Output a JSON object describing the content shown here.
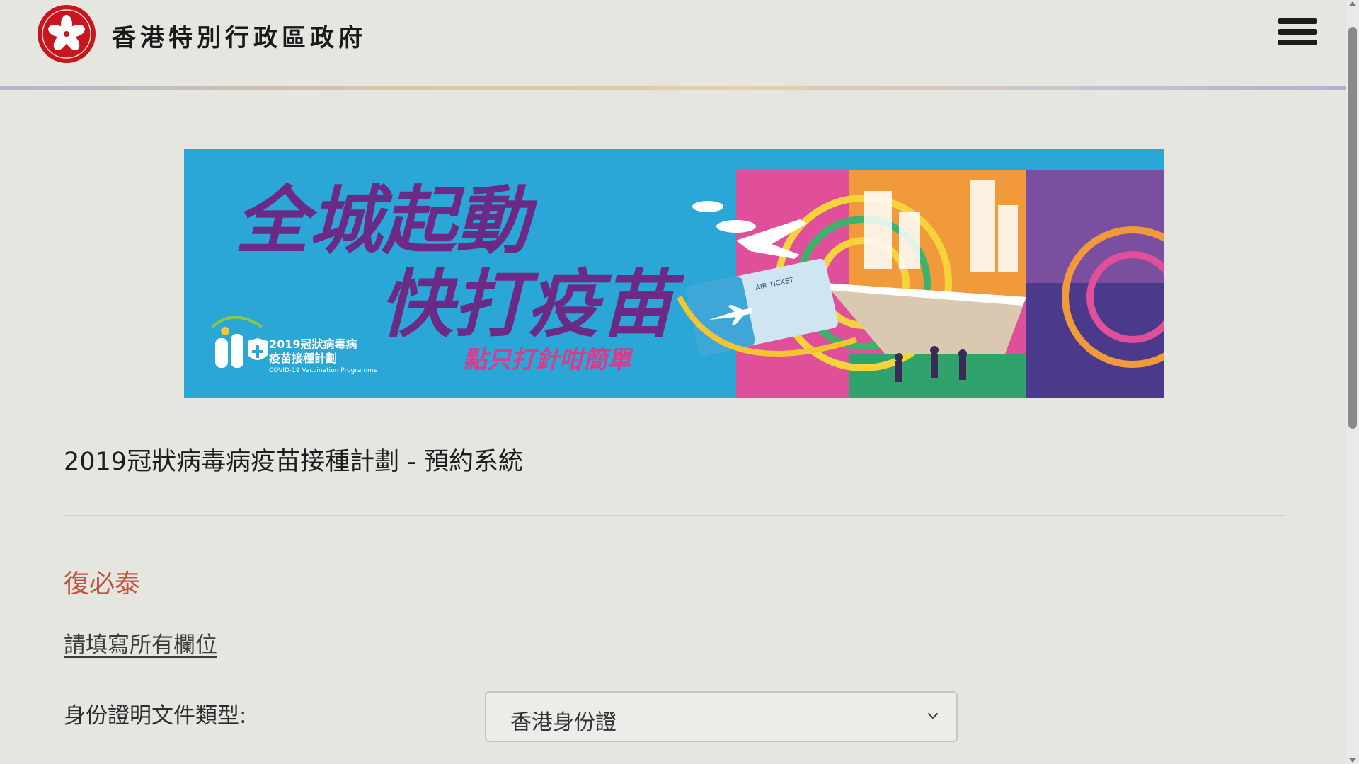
{
  "header": {
    "gov_name": "香港特別行政區政府",
    "emblem_icon": "hksar-emblem-icon",
    "menu_icon": "hamburger-menu-icon"
  },
  "banner": {
    "headline_line1": "全城起動",
    "headline_line2": "快打疫苗",
    "tagline": "點只打針咁簡單",
    "programme_zh_line1": "2019冠狀病毒病",
    "programme_zh_line2": "疫苗接種計劃",
    "programme_en": "COVID-19 Vaccination Programme",
    "ticket_text": "AIR TICKET"
  },
  "main": {
    "page_title": "2019冠狀病毒病疫苗接種計劃 - 預約系統",
    "vaccine_name": "復必泰",
    "fill_all_link": "請填寫所有欄位",
    "id_type_label": "身份證明文件類型:",
    "id_type_value": "香港身份證"
  },
  "colors": {
    "page_bg": "#e6e6e1",
    "banner_bg": "#2aa7d6",
    "headline_purple": "#6a2a86",
    "vaccine_name_red": "#c0523f",
    "emblem_red": "#c8161d"
  }
}
